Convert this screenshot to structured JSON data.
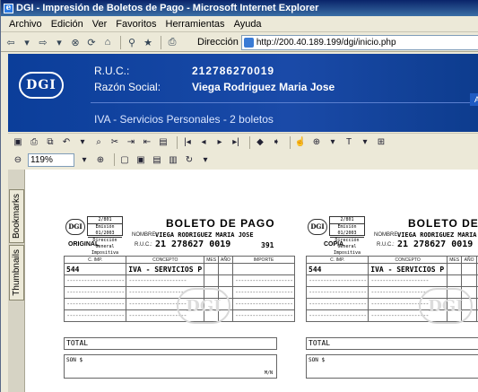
{
  "window": {
    "title": "DGI - Impresión de Boletos de Pago - Microsoft Internet Explorer",
    "title_icon": "ie-icon"
  },
  "menu": [
    "Archivo",
    "Edición",
    "Ver",
    "Favoritos",
    "Herramientas",
    "Ayuda"
  ],
  "address": {
    "label": "Dirección",
    "url": "http://200.40.189.199/dgi/inicio.php"
  },
  "banner": {
    "logo": "DGI",
    "ruc_label": "R.U.C.:",
    "ruc_value": "212786270019",
    "razon_label": "Razón Social:",
    "razon_value": "Viega Rodriguez Maria Jose",
    "subtitle": "IVA - Servicios Personales - 2 boletos",
    "right_fragment": "A"
  },
  "reader": {
    "zoom": "119%",
    "tabs": [
      "Bookmarks",
      "Thumbnails"
    ]
  },
  "boletos": [
    {
      "copy": "ORIGINAL",
      "logo": "DGI",
      "stub": [
        "2/801",
        "Emisión 01/2003",
        "Dirección General Impositiva"
      ],
      "title": "BOLETO DE PAGO",
      "name_label": "NOMBRE:",
      "name": "VIEGA RODRIGUEZ MARIA JOSE",
      "ruc_label": "R.U.C.:",
      "ruc": "21 278627 0019",
      "amount": "391",
      "columns": [
        "C. IMP.",
        "CONCEPTO",
        "MES",
        "AÑO",
        "IMPORTE"
      ],
      "row_code": "544",
      "row_concept": "IVA - SERVICIOS P",
      "dashes": "--------------------",
      "total": "TOTAL",
      "son": "SON $",
      "mn": "M/N"
    },
    {
      "copy": "COPIA",
      "logo": "DGI",
      "stub": [
        "2/801",
        "Emisión 01/2003",
        "Dirección General Impositiva"
      ],
      "title": "BOLETO DE PAG",
      "name_label": "NOMBRE:",
      "name": "VIEGA RODRIGUEZ MARIA",
      "ruc_label": "R.U.C.:",
      "ruc": "21 278627 0019",
      "columns": [
        "C. IMP.",
        "CONCEPTO",
        "MES",
        "AÑO"
      ],
      "row_code": "544",
      "row_concept": "IVA - SERVICIOS P",
      "dashes": "--------------------",
      "total": "TOTAL",
      "son": "SON $"
    }
  ]
}
